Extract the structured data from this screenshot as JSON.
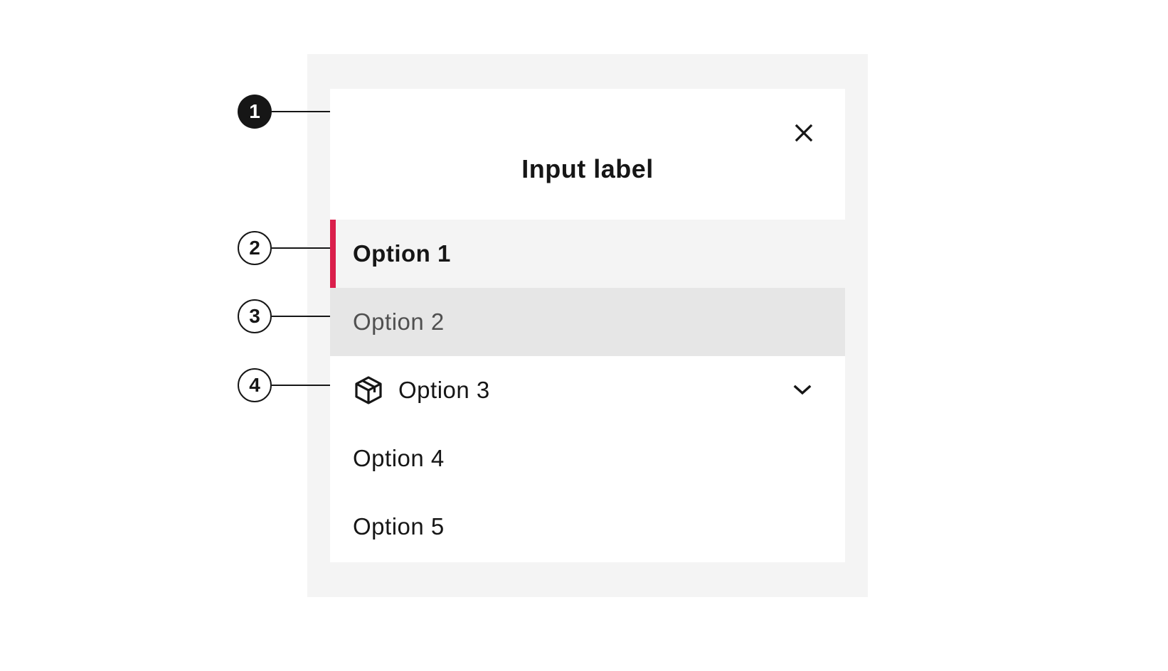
{
  "sheet": {
    "title": "Input label",
    "close_icon": "close-icon"
  },
  "options": [
    {
      "label": "Option 1",
      "state": "selected"
    },
    {
      "label": "Option 2",
      "state": "hover"
    },
    {
      "label": "Option 3",
      "state": "default",
      "icon": "package-icon",
      "trailing_icon": "chevron-down-icon"
    },
    {
      "label": "Option 4",
      "state": "default"
    },
    {
      "label": "Option 5",
      "state": "default"
    }
  ],
  "annotations": [
    {
      "number": "1",
      "style": "filled"
    },
    {
      "number": "2",
      "style": "outline"
    },
    {
      "number": "3",
      "style": "outline"
    },
    {
      "number": "4",
      "style": "outline"
    }
  ],
  "colors": {
    "accent": "#da1e4b",
    "selected_bg": "#f4f4f4",
    "hover_bg": "#e6e6e6",
    "backdrop": "#f4f4f4",
    "text": "#161616"
  }
}
